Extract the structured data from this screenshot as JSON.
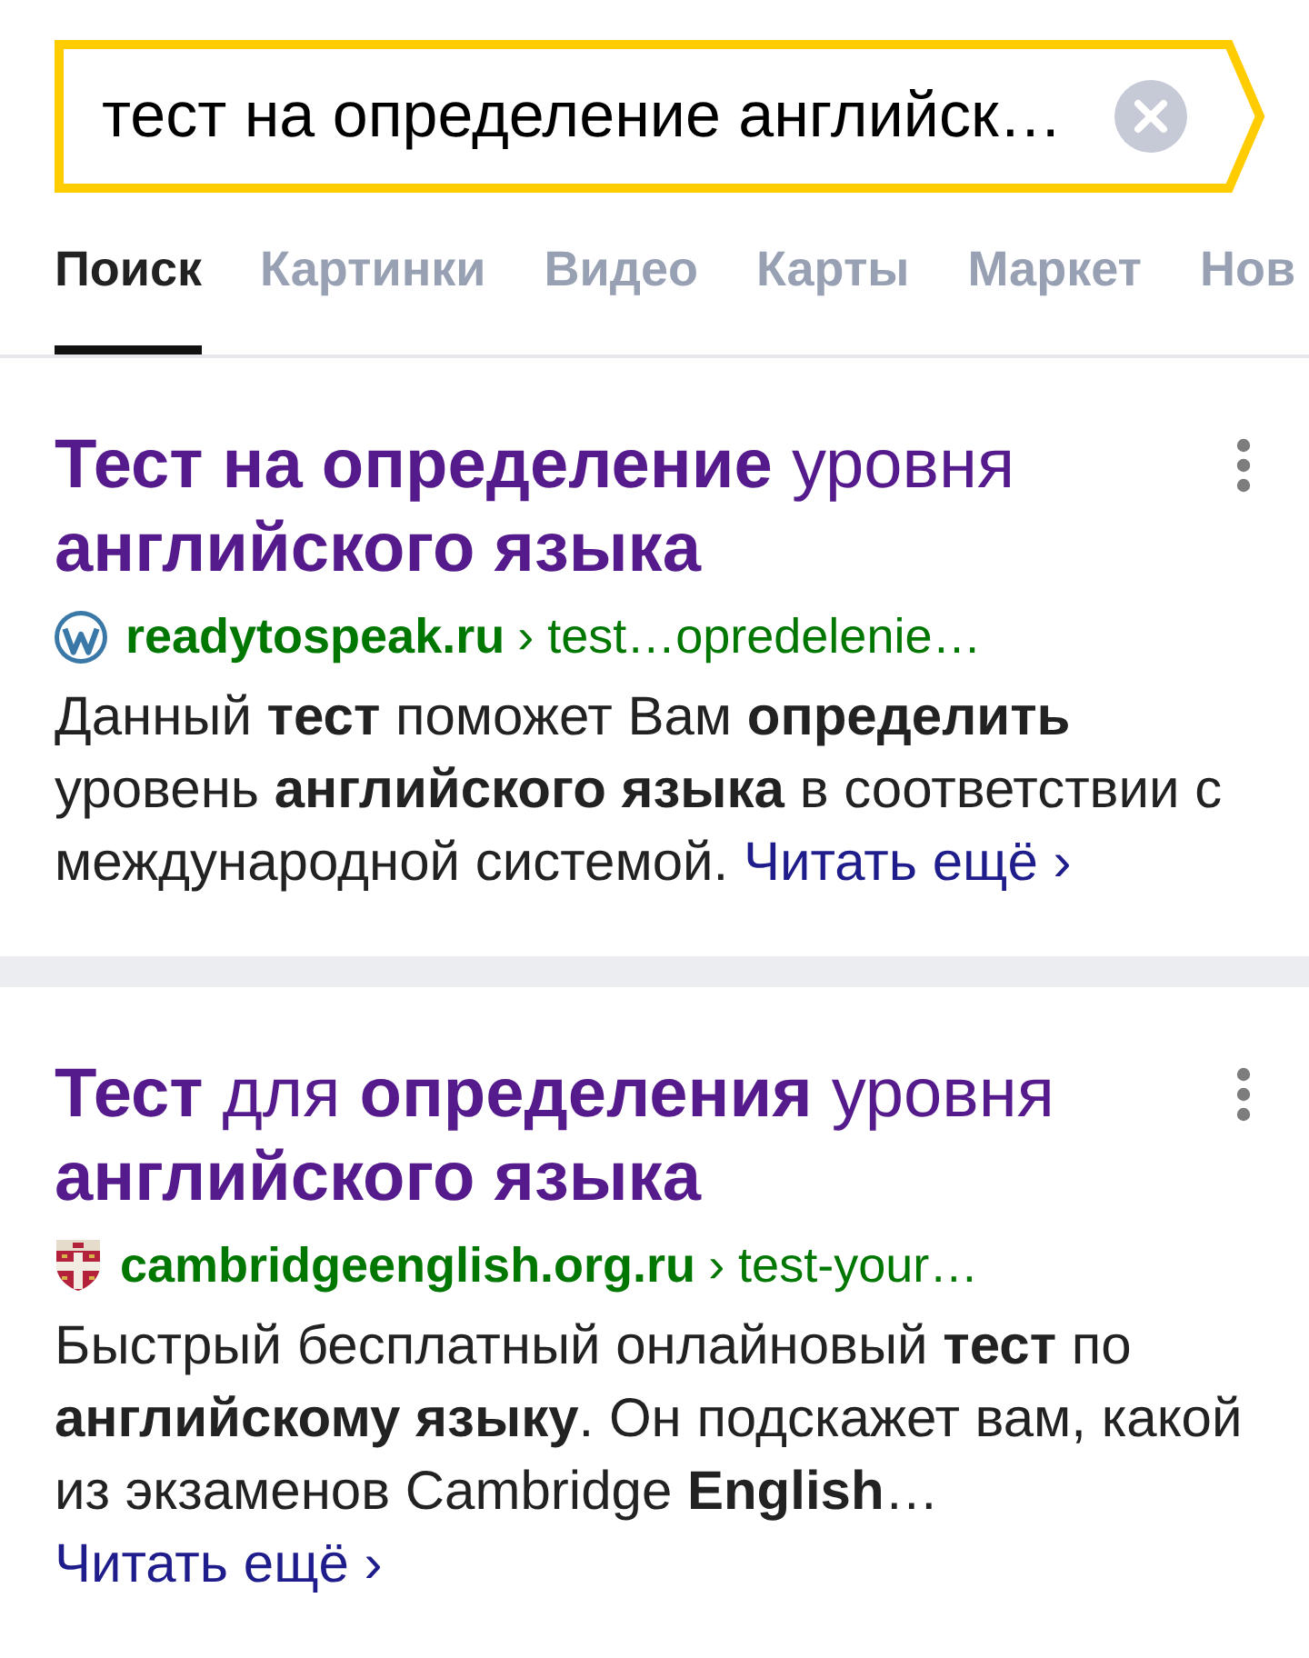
{
  "search": {
    "value": "тест на определение английск…"
  },
  "tabs": [
    {
      "label": "Поиск",
      "selected": true
    },
    {
      "label": "Картинки",
      "selected": false
    },
    {
      "label": "Видео",
      "selected": false
    },
    {
      "label": "Карты",
      "selected": false
    },
    {
      "label": "Маркет",
      "selected": false
    },
    {
      "label": "Нов",
      "selected": false
    }
  ],
  "results": [
    {
      "title": "**Тест на определение** уровня **английского языка**",
      "kind": "circle",
      "site": "readytospeak.ru",
      "path": "› test…opredelenie…",
      "snippet": "Данный **тест** поможет Вам **определить** уровень **английского языка** в соответствии с международной системой.",
      "read_more": "Читать ещё ›"
    },
    {
      "title": "**Тест** для **определения** уровня **английского языка**",
      "kind": "shield",
      "site": "cambridgeenglish.org.ru",
      "path": "› test-your…",
      "snippet": "Быстрый бесплатный онлайновый **тест** по **английскому языку**. Он подскажет вам, какой из экзаменов Cambridge **English**…",
      "read_more": "Читать ещё ›"
    }
  ]
}
